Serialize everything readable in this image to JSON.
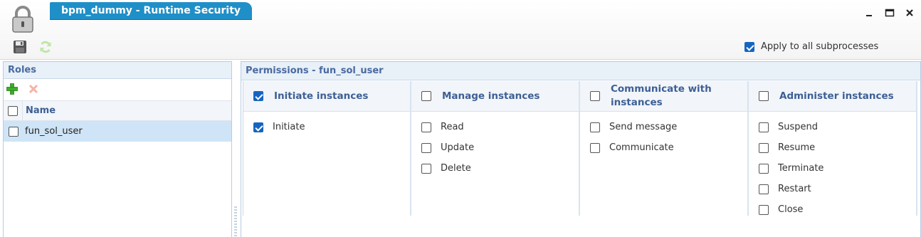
{
  "window": {
    "title": "bpm_dummy - Runtime Security",
    "controls": [
      "minimize-icon",
      "maximize-icon",
      "close-icon"
    ]
  },
  "toolbar": {
    "icons": [
      "save-icon",
      "refresh-icon"
    ],
    "apply_all": {
      "label": "Apply to all subprocesses",
      "checked": true
    }
  },
  "roles": {
    "title": "Roles",
    "icons": [
      "add-icon",
      "delete-icon"
    ],
    "column_name": "Name",
    "rows": [
      {
        "name": "fun_sol_user",
        "checked": false,
        "selected": true
      }
    ]
  },
  "permissions": {
    "title": "Permissions - fun_sol_user",
    "columns": [
      {
        "header": "Initiate instances",
        "checked": true,
        "items": [
          {
            "label": "Initiate",
            "checked": true
          }
        ]
      },
      {
        "header": "Manage instances",
        "checked": false,
        "items": [
          {
            "label": "Read",
            "checked": false
          },
          {
            "label": "Update",
            "checked": false
          },
          {
            "label": "Delete",
            "checked": false
          }
        ]
      },
      {
        "header": "Communicate with instances",
        "checked": false,
        "items": [
          {
            "label": "Send message",
            "checked": false
          },
          {
            "label": "Communicate",
            "checked": false
          }
        ]
      },
      {
        "header": "Administer instances",
        "checked": false,
        "items": [
          {
            "label": "Suspend",
            "checked": false
          },
          {
            "label": "Resume",
            "checked": false
          },
          {
            "label": "Terminate",
            "checked": false
          },
          {
            "label": "Restart",
            "checked": false
          },
          {
            "label": "Close",
            "checked": false
          }
        ]
      }
    ]
  },
  "colors": {
    "accent": "#1f8fc8",
    "header_text": "#3d5f95",
    "selected_row": "#cfe4f6",
    "checkbox_on": "#1565c0"
  }
}
